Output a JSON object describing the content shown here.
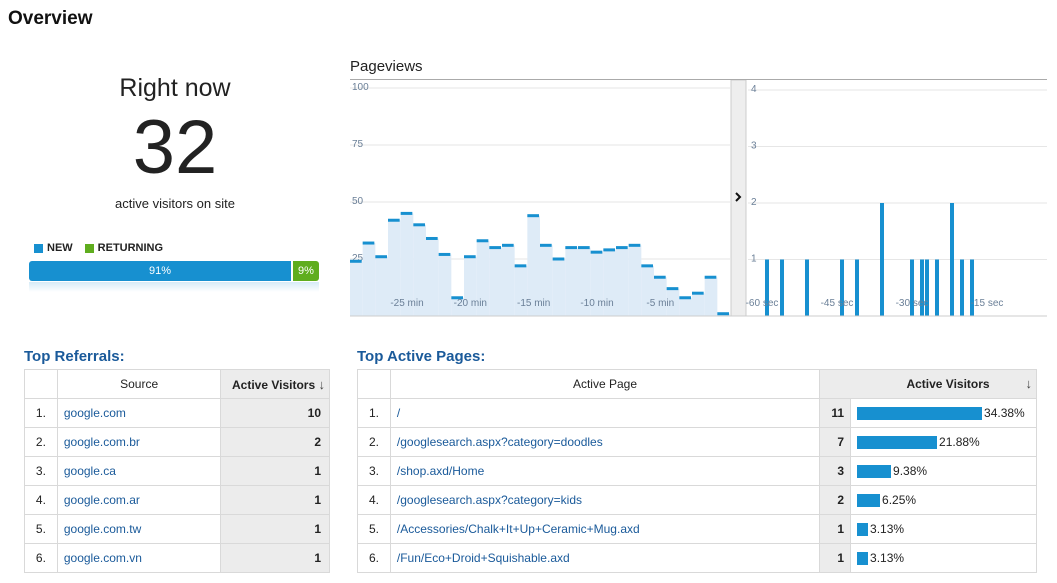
{
  "page": {
    "title": "Overview"
  },
  "right_now": {
    "heading": "Right now",
    "count": "32",
    "subtitle": "active visitors on site",
    "legend": {
      "new": "NEW",
      "returning": "RETURNING"
    },
    "new_pct_label": "91%",
    "returning_pct_label": "9%",
    "new_fraction": 0.91,
    "returning_fraction": 0.09,
    "colors": {
      "new": "#1790d0",
      "returning": "#5fad1e"
    }
  },
  "pageviews": {
    "title": "Pageviews"
  },
  "chart_data": [
    {
      "type": "area",
      "title": "Pageviews",
      "ylim": [
        0,
        100
      ],
      "yticks": [
        "100",
        "75",
        "50",
        "25"
      ],
      "x": [
        -29,
        -28,
        -27,
        -26,
        -25,
        -24,
        -23,
        -22,
        -21,
        -20,
        -19,
        -18,
        -17,
        -16,
        -15,
        -14,
        -13,
        -12,
        -11,
        -10,
        -9,
        -8,
        -7,
        -6,
        -5,
        -4,
        -3,
        -2,
        -1,
        0
      ],
      "values": [
        24,
        32,
        26,
        42,
        45,
        40,
        34,
        27,
        8,
        26,
        33,
        30,
        31,
        22,
        44,
        31,
        25,
        30,
        30,
        28,
        29,
        30,
        31,
        22,
        17,
        12,
        8,
        10,
        17,
        1
      ],
      "xticks": [
        "-25 min",
        "-20 min",
        "-15 min",
        "-10 min",
        "-5 min"
      ],
      "colors": {
        "fill": "#deebf7",
        "line": "#1790d0"
      }
    },
    {
      "type": "bar",
      "ylim": [
        0,
        4
      ],
      "yticks": [
        "4",
        "3",
        "2",
        "1"
      ],
      "x": [
        -59,
        -56,
        -51,
        -44,
        -41,
        -36,
        -30,
        -28,
        -27,
        -25,
        -22,
        -20,
        -18
      ],
      "values": [
        1,
        1,
        1,
        1,
        1,
        2,
        1,
        1,
        1,
        1,
        2,
        1,
        1
      ],
      "xticks": [
        "-60 sec",
        "-45 sec",
        "-30 sec",
        "-15 sec"
      ],
      "colors": {
        "bar": "#1790d0"
      }
    }
  ],
  "referrals": {
    "title": "Top Referrals:",
    "col_source": "Source",
    "col_visitors": "Active Visitors",
    "rows": [
      {
        "rank": "1.",
        "source": "google.com",
        "visitors": "10"
      },
      {
        "rank": "2.",
        "source": "google.com.br",
        "visitors": "2"
      },
      {
        "rank": "3.",
        "source": "google.ca",
        "visitors": "1"
      },
      {
        "rank": "4.",
        "source": "google.com.ar",
        "visitors": "1"
      },
      {
        "rank": "5.",
        "source": "google.com.tw",
        "visitors": "1"
      },
      {
        "rank": "6.",
        "source": "google.com.vn",
        "visitors": "1"
      }
    ]
  },
  "pages": {
    "title": "Top Active Pages:",
    "col_page": "Active Page",
    "col_visitors": "Active Visitors",
    "rows": [
      {
        "rank": "1.",
        "page": "/",
        "visitors": "11",
        "pct": "34.38%",
        "fraction": 0.3438
      },
      {
        "rank": "2.",
        "page": "/googlesearch.aspx?category=doodles",
        "visitors": "7",
        "pct": "21.88%",
        "fraction": 0.2188
      },
      {
        "rank": "3.",
        "page": "/shop.axd/Home",
        "visitors": "3",
        "pct": "9.38%",
        "fraction": 0.0938
      },
      {
        "rank": "4.",
        "page": "/googlesearch.aspx?category=kids",
        "visitors": "2",
        "pct": "6.25%",
        "fraction": 0.0625
      },
      {
        "rank": "5.",
        "page": "/Accessories/Chalk+It+Up+Ceramic+Mug.axd",
        "visitors": "1",
        "pct": "3.13%",
        "fraction": 0.0313
      },
      {
        "rank": "6.",
        "page": "/Fun/Eco+Droid+Squishable.axd",
        "visitors": "1",
        "pct": "3.13%",
        "fraction": 0.0313
      }
    ]
  },
  "icons": {
    "sort": "arrow-down-icon",
    "expand": "chevron-right-icon"
  }
}
